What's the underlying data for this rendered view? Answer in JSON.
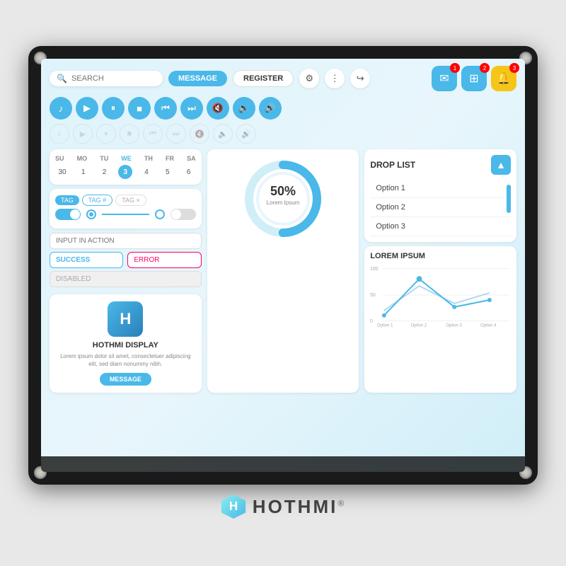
{
  "monitor": {
    "screen_bg": "#def3fb"
  },
  "topbar": {
    "search_placeholder": "SEARCH",
    "btn_message": "MESSAGE",
    "btn_register": "REGISTER",
    "icons": [
      "⚙",
      "⋮",
      "↪"
    ],
    "top_right": [
      {
        "icon": "✉",
        "color": "#4ab8e8",
        "badge": "1"
      },
      {
        "icon": "▦",
        "color": "#4ab8e8",
        "badge": "2"
      },
      {
        "icon": "🔔",
        "color": "#f5c518",
        "badge": "3"
      }
    ]
  },
  "media": {
    "row1": [
      "♪",
      "▶",
      "⏸",
      "■",
      "⏮",
      "⏭",
      "🔇",
      "🔈",
      "🔊"
    ],
    "row2": [
      "♪",
      "▶",
      "⏸",
      "■",
      "⏮",
      "⏭",
      "🔇",
      "🔈",
      "🔊"
    ]
  },
  "calendar": {
    "days": [
      "SU",
      "MO",
      "TU",
      "WE",
      "TH",
      "FR",
      "SA"
    ],
    "dates": [
      "30",
      "1",
      "2",
      "3",
      "4",
      "5",
      "6"
    ],
    "active_day_index": 3
  },
  "tags": [
    {
      "label": "TAG",
      "style": "active"
    },
    {
      "label": "TAG #",
      "style": "outline"
    },
    {
      "label": "TAG ×",
      "style": "close"
    }
  ],
  "inputs": {
    "placeholder": "INPUT IN ACTION",
    "success_text": "SUCCESS",
    "error_text": "ERROR",
    "disabled_text": "DISABLED"
  },
  "card": {
    "title": "HOTHMI DISPLAY",
    "text": "Lorem ipsum dolor sit amet, consectetuer adipiscing elit, sed diam nonummy nibh.",
    "btn_label": "MESSAGE",
    "logo_letter": "H"
  },
  "gauge": {
    "percent": 50,
    "label": "Lorem Ipsum",
    "color_primary": "#4ab8e8",
    "color_secondary": "#d0eef8"
  },
  "droplist": {
    "title": "DROP LIST",
    "items": [
      "Option 1",
      "Option 2",
      "Option 3"
    ]
  },
  "chart": {
    "title": "LOREM IPSUM",
    "x_labels": [
      "Option 1",
      "Option 2",
      "Option 3",
      "Option 4"
    ],
    "y_labels": [
      "100",
      "50",
      "0"
    ],
    "line1_color": "#b0d8ee",
    "line2_color": "#4ab8e8",
    "dot_color": "#4ab8e8"
  },
  "brand": {
    "name": "HOTHMI",
    "registered": "®"
  }
}
